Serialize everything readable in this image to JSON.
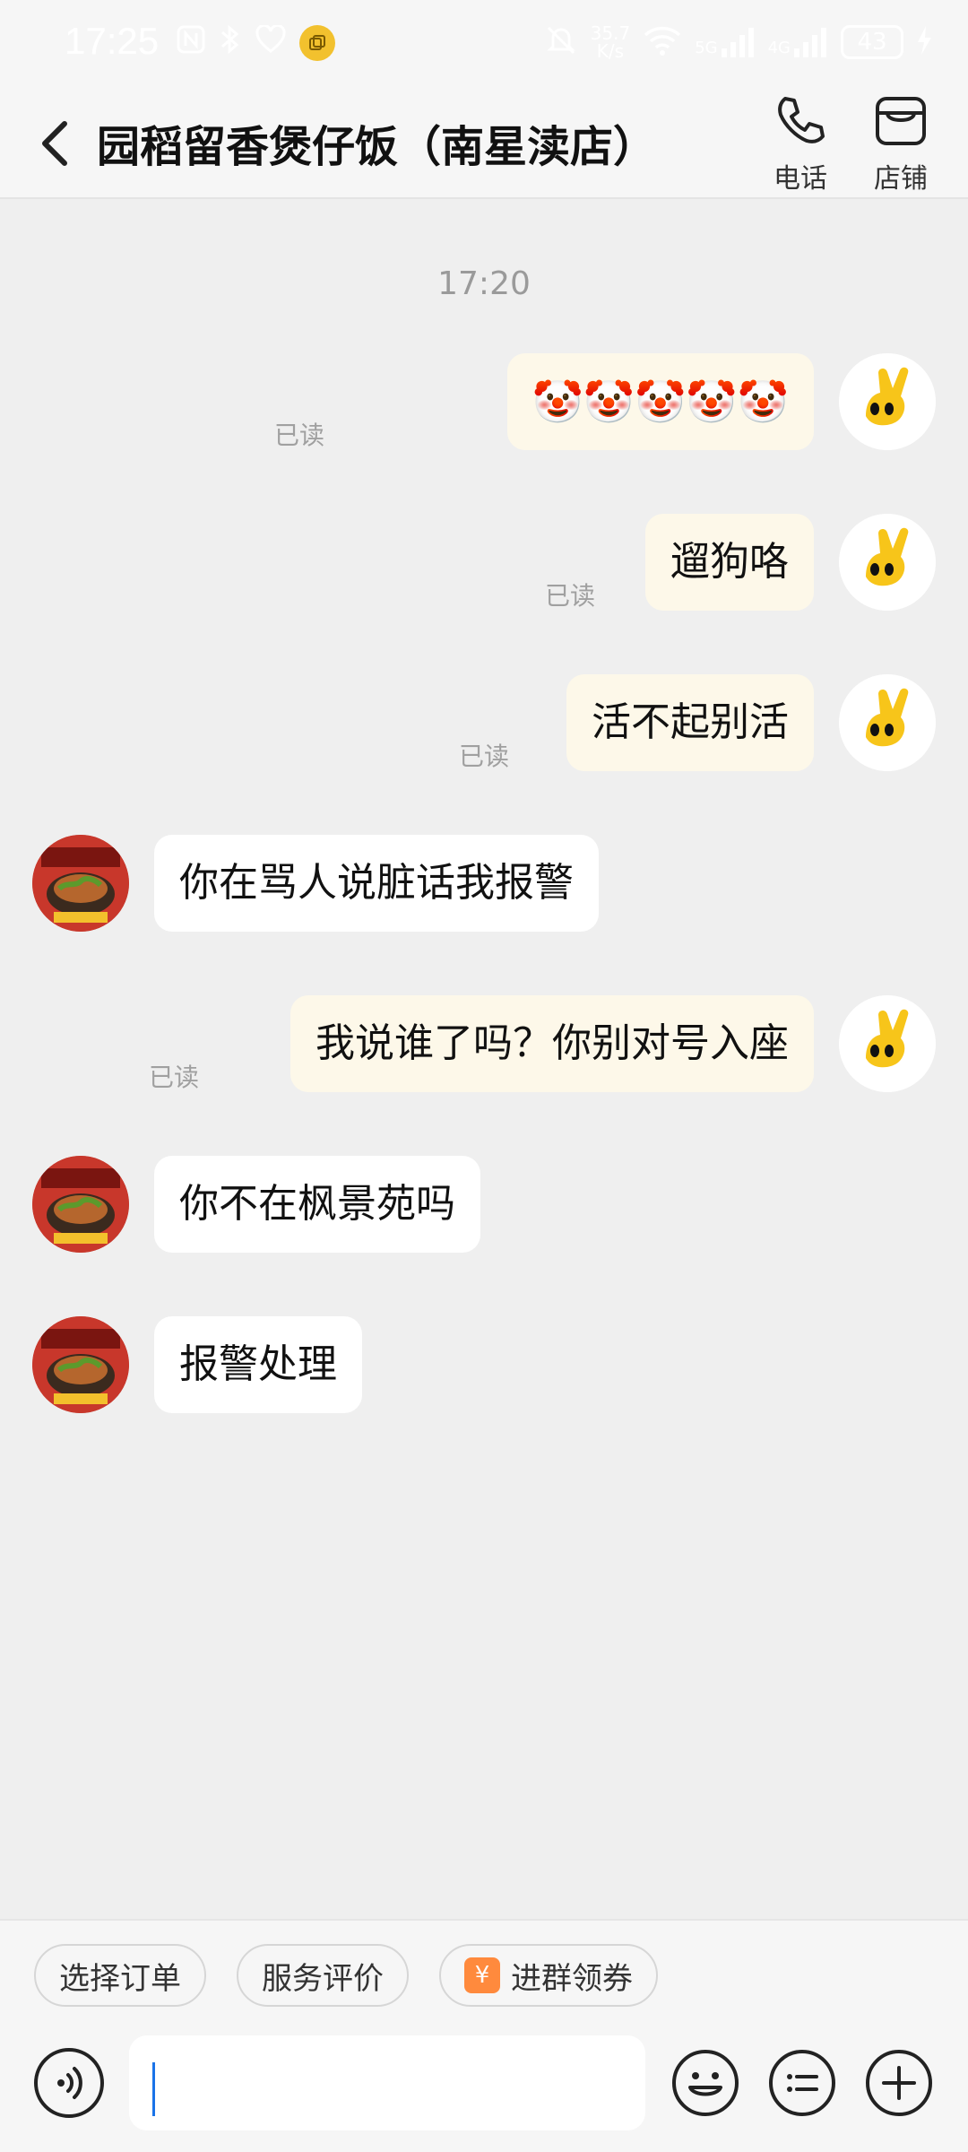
{
  "status_bar": {
    "time": "17:25",
    "net_speed_value": "35.7",
    "net_speed_unit": "K/s",
    "net_5g": "5G",
    "net_4g": "4G",
    "battery": "43"
  },
  "header": {
    "title": "园稻留香煲仔饭（南星渎店）",
    "call_label": "电话",
    "shop_label": "店铺"
  },
  "chat": {
    "timestamp": "17:20",
    "read_label": "已读",
    "messages": [
      {
        "from": "me",
        "text": "🤡🤡🤡🤡🤡",
        "read": true
      },
      {
        "from": "me",
        "text": "遛狗咯",
        "read": true
      },
      {
        "from": "me",
        "text": "活不起别活",
        "read": true
      },
      {
        "from": "shop",
        "text": "你在骂人说脏话我报警"
      },
      {
        "from": "me",
        "text": "我说谁了吗？你别对号入座",
        "read": true
      },
      {
        "from": "shop",
        "text": "你不在枫景苑吗"
      },
      {
        "from": "shop",
        "text": "报警处理"
      }
    ]
  },
  "quick_actions": {
    "select_order": "选择订单",
    "service_review": "服务评价",
    "join_group": "进群领券",
    "coupon_glyph": "¥"
  },
  "composer": {
    "value": "",
    "placeholder": ""
  }
}
